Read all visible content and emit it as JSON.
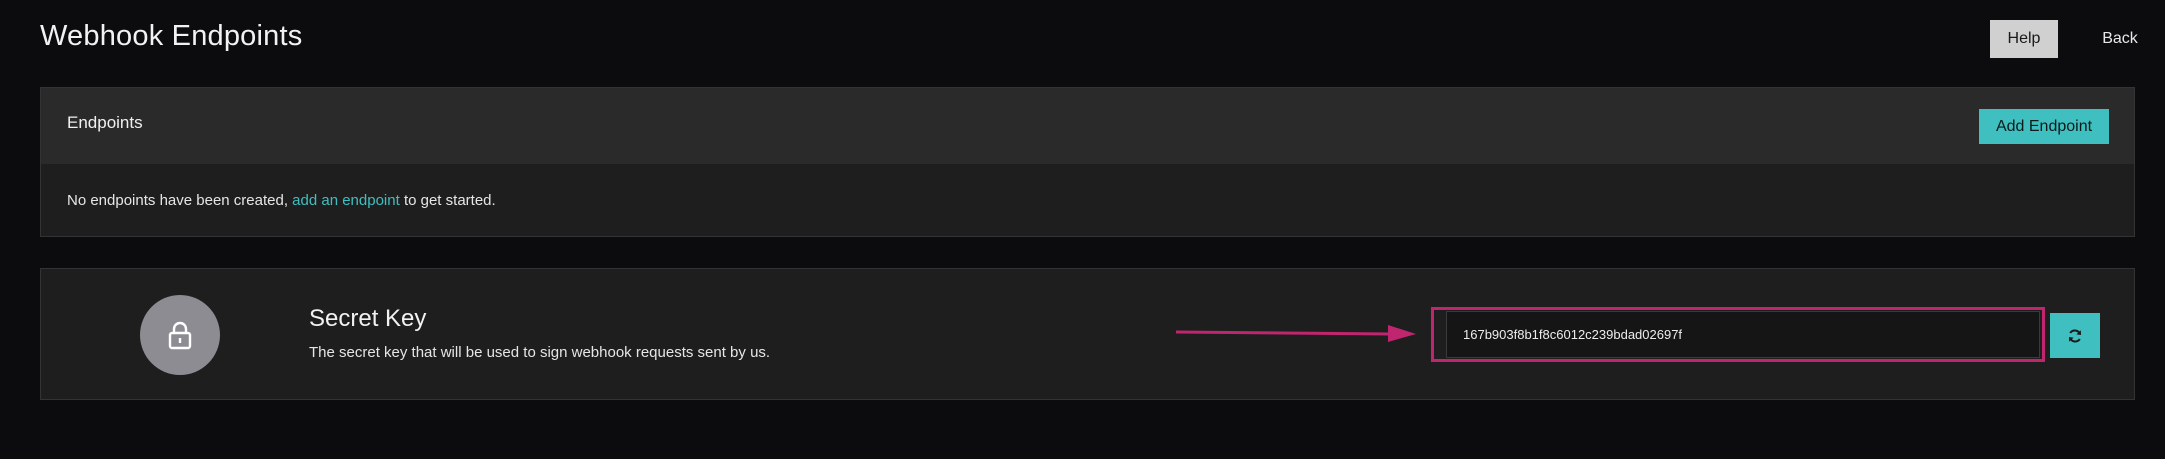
{
  "header": {
    "title": "Webhook Endpoints",
    "help_label": "Help",
    "back_label": "Back"
  },
  "endpoints": {
    "title": "Endpoints",
    "add_button_label": "Add Endpoint",
    "empty_prefix": "No endpoints have been created, ",
    "empty_link": "add an endpoint",
    "empty_suffix": " to get started."
  },
  "secret": {
    "title": "Secret Key",
    "description": "The secret key that will be used to sign webhook requests sent by us.",
    "key_value": "167b903f8b1f8c6012c239bdad02697f"
  },
  "icons": {
    "lock": "lock-icon",
    "refresh": "refresh-icon",
    "annotation_arrow": "arrow-right-icon"
  },
  "colors": {
    "accent": "#3fbfbf",
    "highlight": "#c0256f",
    "background": "#0c0c0e"
  }
}
